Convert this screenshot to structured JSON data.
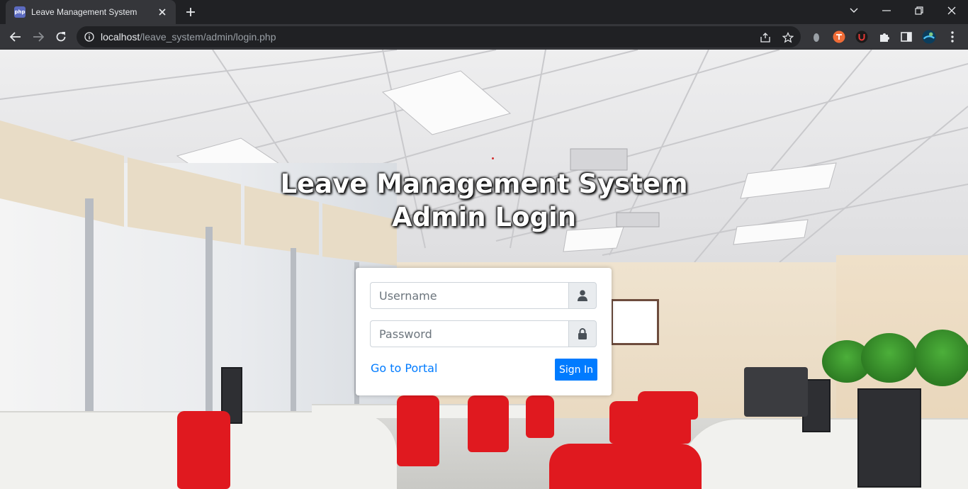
{
  "browser": {
    "tab_title": "Leave Management System",
    "favicon_text": "php",
    "url_host": "localhost",
    "url_path": "/leave_system/admin/login.php"
  },
  "page": {
    "heading_line1": "Leave Management System",
    "heading_line2": "Admin Login"
  },
  "login": {
    "username_placeholder": "Username",
    "password_placeholder": "Password",
    "portal_link": "Go to Portal",
    "signin_label": "Sign In"
  },
  "colors": {
    "primary": "#007bff",
    "chrome_dark": "#202124",
    "chrome_toolbar": "#35363a"
  }
}
